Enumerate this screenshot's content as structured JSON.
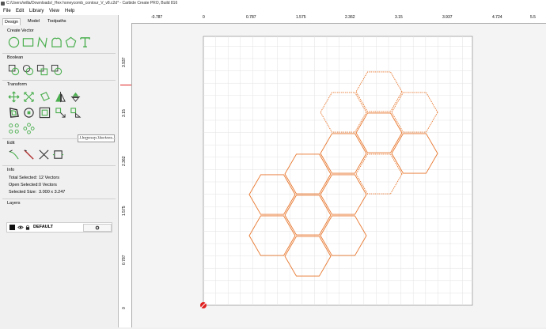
{
  "window": {
    "title": "C:/Users/willa/Downloads/_Hex honeycomb_contour_V_v8.c2d* - Carbide Create PRO, Build 816"
  },
  "menu": {
    "file": "File",
    "edit": "Edit",
    "library": "Library",
    "view": "View",
    "help": "Help"
  },
  "tabs": {
    "design": "Design",
    "model": "Model",
    "toolpaths": "Toolpaths"
  },
  "sections": {
    "create_vector": "Create Vector",
    "boolean": "Boolean",
    "transform": "Transform",
    "edit": "Edit",
    "info": "Info",
    "layers": "Layers"
  },
  "tooltip": "Ungroup Vectors",
  "info": {
    "total_selected_label": "Total Selected:",
    "total_selected_value": "12 Vectors",
    "open_selected_label": "Open Selected:",
    "open_selected_value": "0 Vectors",
    "selected_size_label": "Selected Size:",
    "selected_size_value": "3.000 x 3.247"
  },
  "layers": {
    "default_name": "DEFAULT"
  },
  "ruler_top": [
    "-0.787",
    "0",
    "0.787",
    "1.575",
    "2.362",
    "3.15",
    "3.937",
    "4.724",
    "5.5"
  ],
  "ruler_left": [
    "3.937",
    "3.15",
    "2.362",
    "1.575",
    "0.787",
    "0"
  ],
  "colors": {
    "accent": "#4caf50",
    "selection": "#e8762c",
    "origin": "#e02020"
  }
}
